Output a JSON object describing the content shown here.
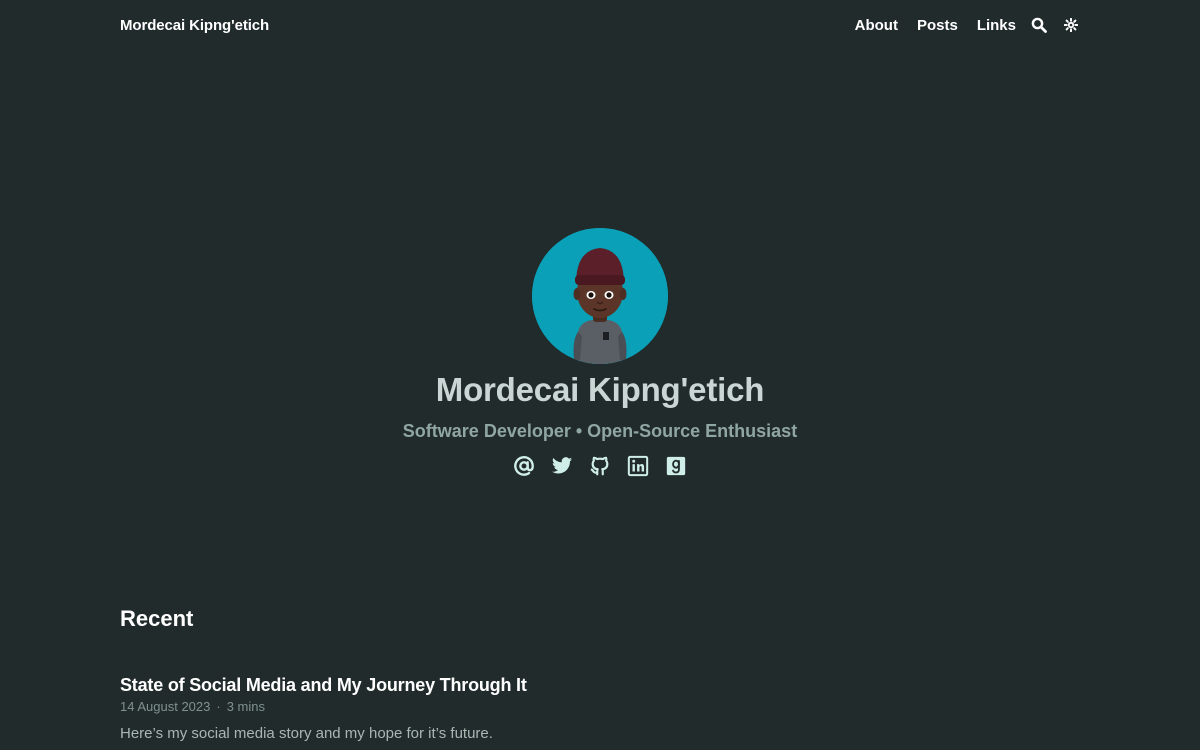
{
  "header": {
    "site_title": "Mordecai Kipng'etich",
    "nav": {
      "about": "About",
      "posts": "Posts",
      "links": "Links"
    },
    "icons": {
      "search": "search-icon",
      "theme": "theme-toggle-icon"
    }
  },
  "hero": {
    "name": "Mordecai Kipng'etich",
    "tagline": "Software Developer • Open-Source Enthusiast",
    "avatar_background": "#0aa1b8",
    "social": [
      {
        "icon": "email-icon",
        "label": "Email"
      },
      {
        "icon": "twitter-icon",
        "label": "Twitter"
      },
      {
        "icon": "github-icon",
        "label": "GitHub"
      },
      {
        "icon": "linkedin-icon",
        "label": "LinkedIn"
      },
      {
        "icon": "goodreads-icon",
        "label": "Goodreads"
      }
    ]
  },
  "recent": {
    "heading": "Recent",
    "posts": [
      {
        "title": "State of Social Media and My Journey Through It",
        "date": "14 August 2023",
        "separator": "·",
        "reading_time": "3 mins",
        "summary": "Here’s my social media story and my hope for it’s future."
      }
    ]
  },
  "colors": {
    "background": "#212b2b",
    "text_primary": "#ffffff",
    "hero_name": "#c9d6d3",
    "hero_tagline": "#90a6a1",
    "social_icon": "#cfeee9",
    "meta": "#7f918d"
  }
}
